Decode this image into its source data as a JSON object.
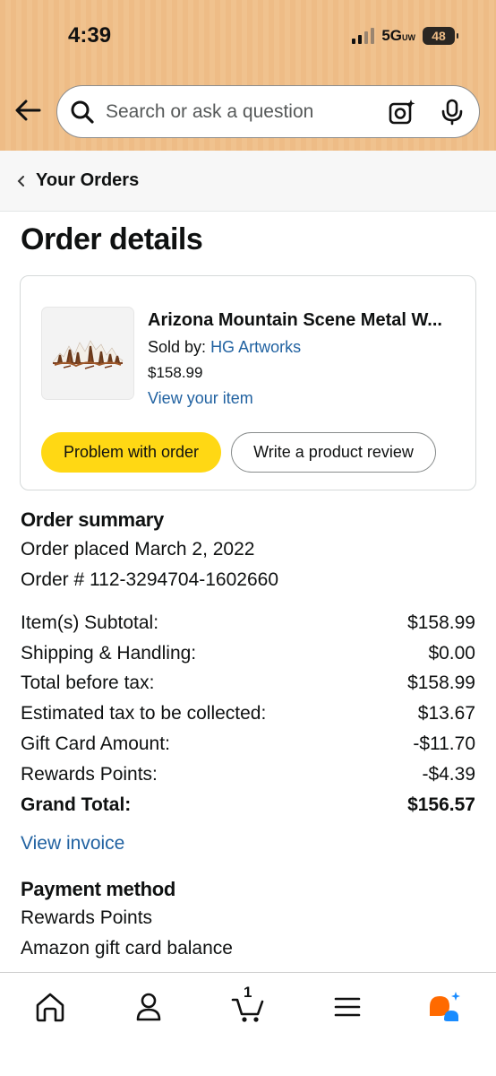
{
  "status_bar": {
    "time": "4:39",
    "network": "5G",
    "network_sub": "UW",
    "battery": "48"
  },
  "search": {
    "placeholder": "Search or ask a question"
  },
  "icons": [
    "back-arrow-icon",
    "search-icon",
    "camera-icon",
    "mic-icon",
    "chevron-left-icon",
    "home-icon",
    "account-icon",
    "cart-icon",
    "menu-icon",
    "rufus-icon"
  ],
  "breadcrumb": {
    "label": "Your Orders"
  },
  "page": {
    "title": "Order details"
  },
  "item": {
    "title": "Arizona Mountain Scene Metal W...",
    "sold_by_label": "Sold by:",
    "seller": "HG Artworks",
    "price": "$158.99",
    "view_item": "View your item"
  },
  "actions": {
    "problem": "Problem with order",
    "review": "Write a product review"
  },
  "summary": {
    "title": "Order summary",
    "placed": "Order placed March 2, 2022",
    "order_number": "Order # 112-3294704-1602660",
    "rows": [
      {
        "label": "Item(s) Subtotal:",
        "value": "$158.99"
      },
      {
        "label": "Shipping & Handling:",
        "value": "$0.00"
      },
      {
        "label": "Total before tax:",
        "value": "$158.99"
      },
      {
        "label": "Estimated tax to be collected:",
        "value": "$13.67"
      },
      {
        "label": "Gift Card Amount:",
        "value": "-$11.70"
      },
      {
        "label": "Rewards Points:",
        "value": "-$4.39"
      },
      {
        "label": "Grand Total:",
        "value": "$156.57"
      }
    ],
    "view_invoice": "View invoice"
  },
  "payment": {
    "title": "Payment method",
    "methods": [
      "Rewards Points",
      "Amazon gift card balance"
    ]
  },
  "bottom_nav": {
    "cart_count": "1"
  },
  "colors": {
    "header": "#eebc86",
    "link": "#2162a1",
    "primary_button": "#ffd814",
    "rufus_orange": "#ff6a00",
    "rufus_blue": "#1a8cff"
  }
}
